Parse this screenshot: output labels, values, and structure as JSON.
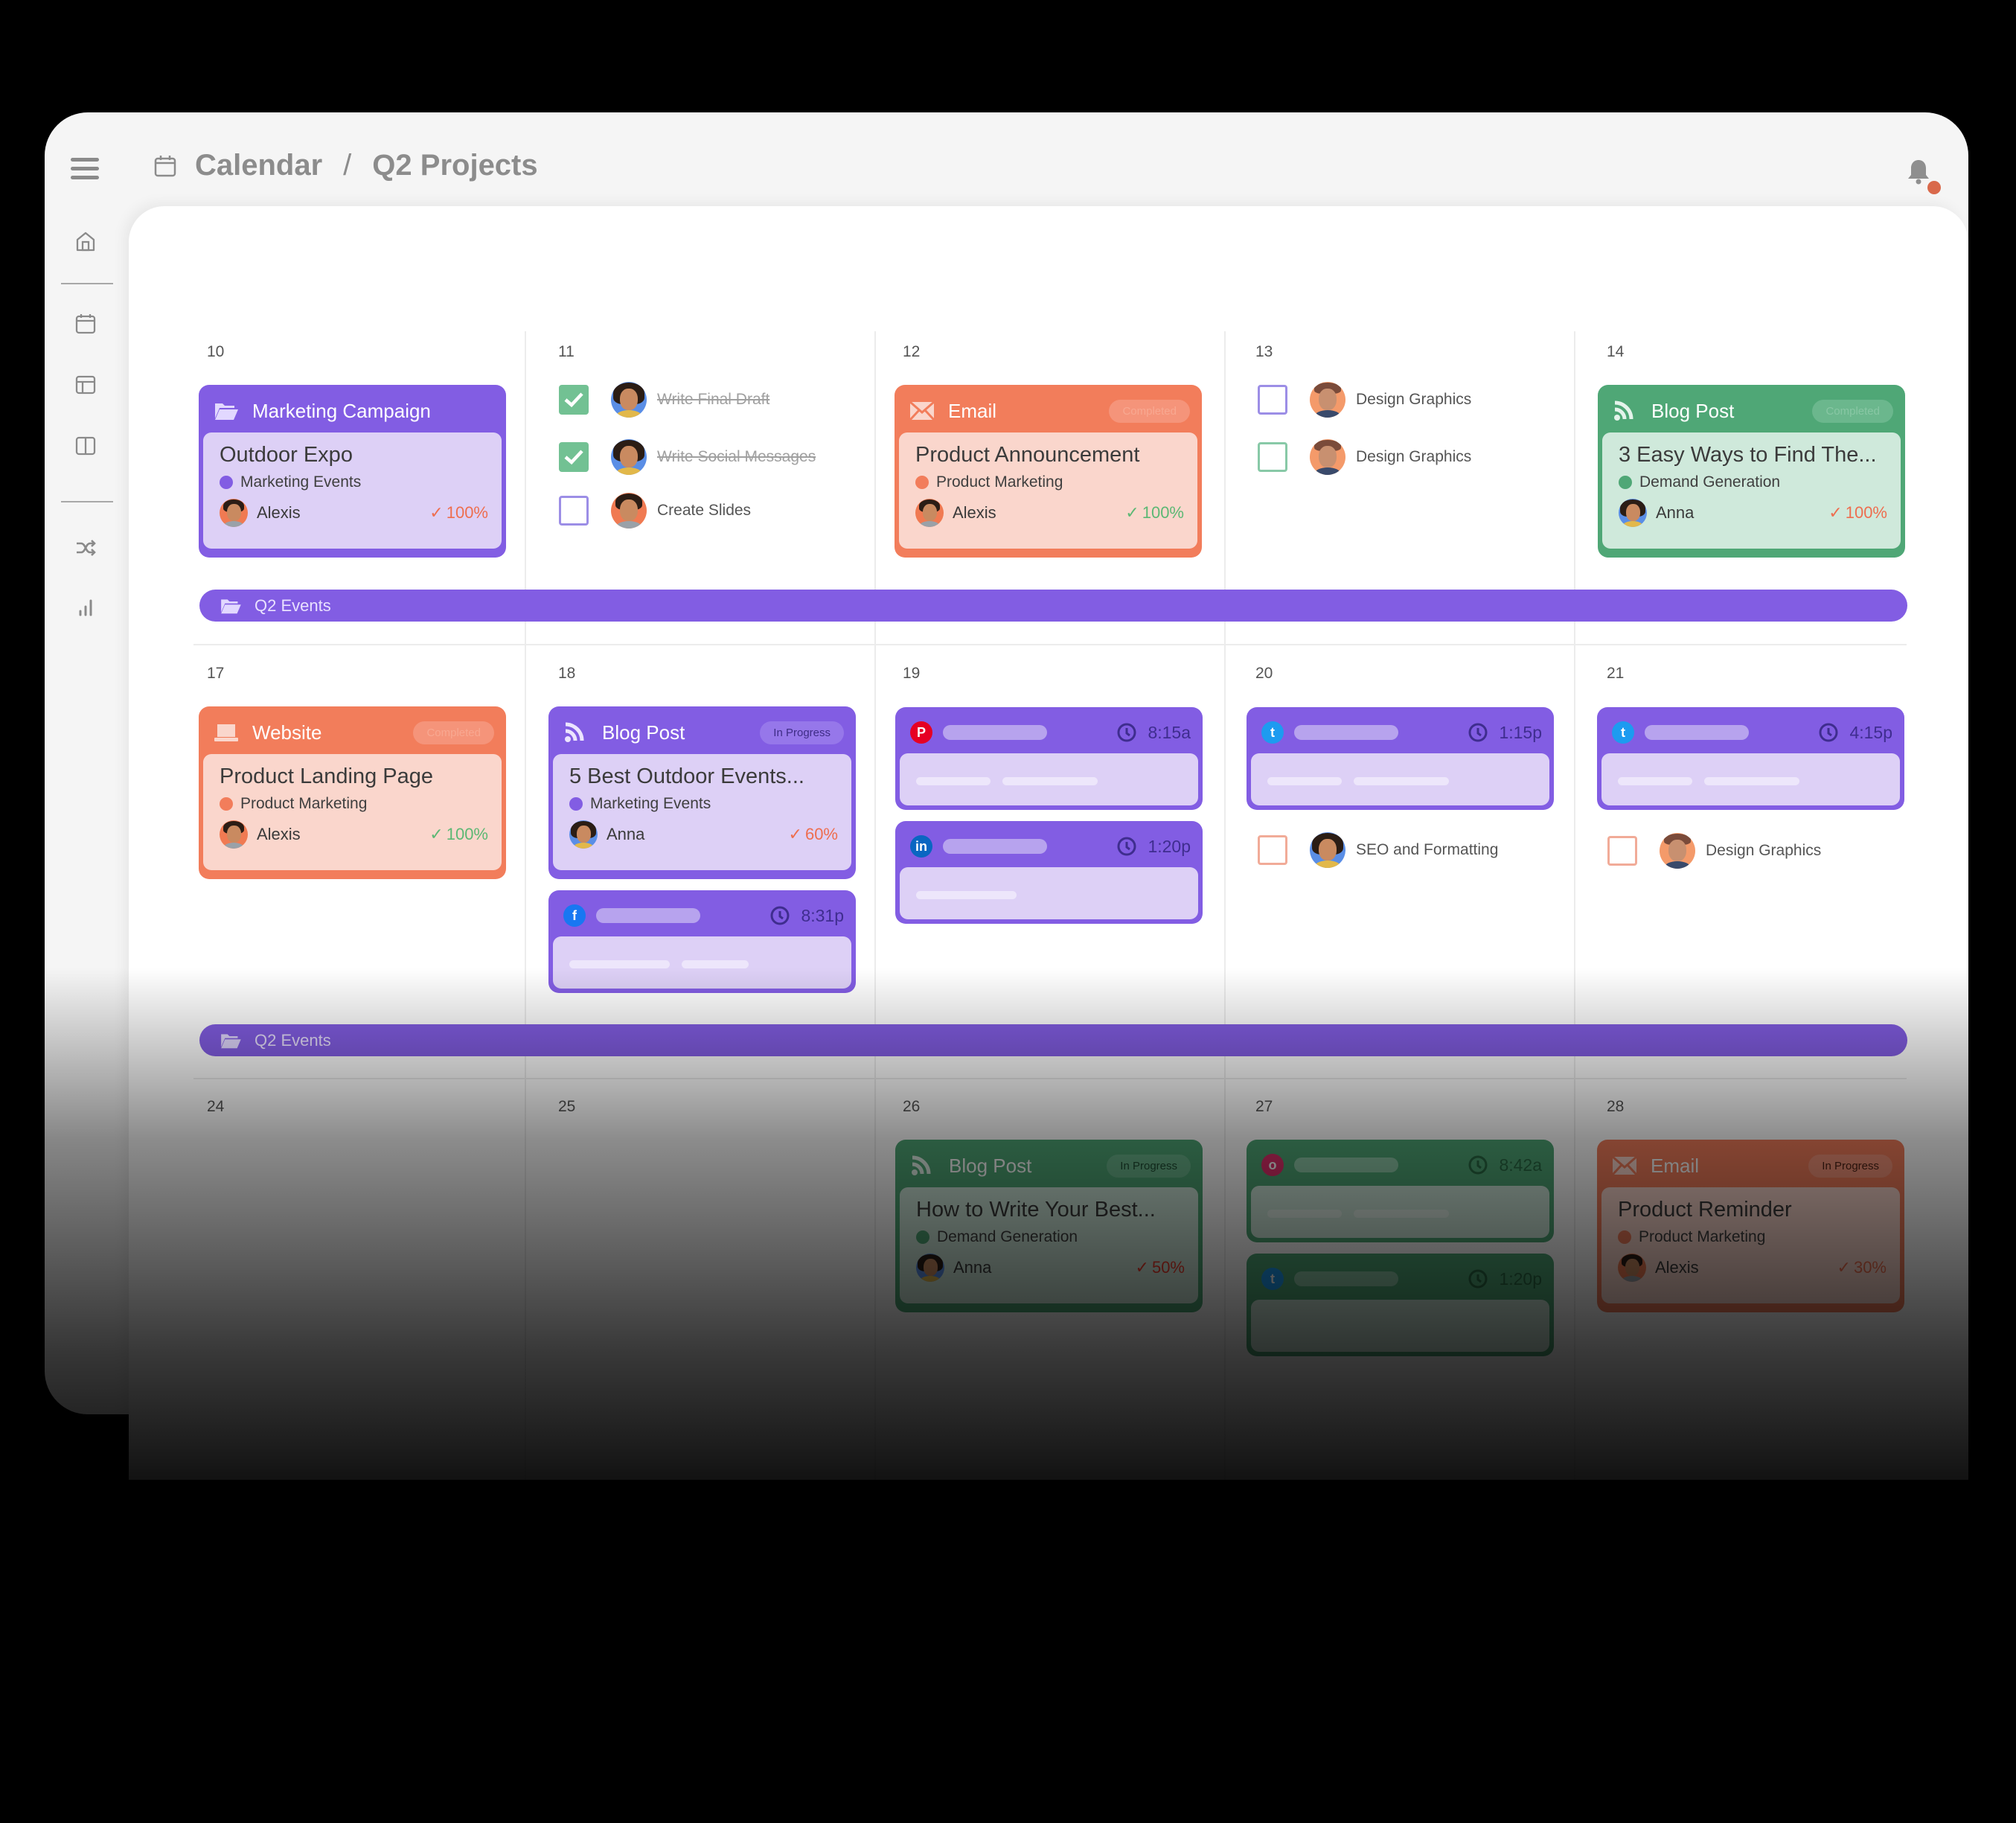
{
  "header": {
    "menu_icon": "hamburger-menu-icon",
    "breadcrumb": {
      "icon": "calendar-icon",
      "root": "Calendar",
      "separator": "/",
      "current": "Q2 Projects"
    },
    "notification_icon": "bell-icon",
    "notification_dot_color": "#d9694b"
  },
  "sidebar": {
    "items": [
      {
        "icon": "home-icon"
      },
      {
        "icon": "calendar-icon"
      },
      {
        "icon": "layout-icon"
      },
      {
        "icon": "columns-icon"
      },
      {
        "icon": "shuffle-icon"
      },
      {
        "icon": "bar-chart-icon"
      }
    ]
  },
  "colors": {
    "purple": "#825de3",
    "orange": "#f27d5b",
    "green": "#4fa776",
    "check_green": "#72c193",
    "pct_green": "#5cb874",
    "pct_orange": "#ee6e4f"
  },
  "calendar": {
    "weeks": [
      {
        "days": [
          "10",
          "11",
          "12",
          "13",
          "14"
        ],
        "banner": {
          "label": "Q2 Events",
          "icon": "folder-open-icon"
        }
      },
      {
        "days": [
          "17",
          "18",
          "19",
          "20",
          "21"
        ],
        "banner": {
          "label": "Q2 Events",
          "icon": "folder-open-icon"
        }
      },
      {
        "days": [
          "24",
          "25",
          "26",
          "27",
          "28"
        ]
      }
    ],
    "cards": {
      "d10": {
        "type": "Marketing Campaign",
        "icon": "folder-open-icon",
        "title": "Outdoor Expo",
        "tag": "Marketing Events",
        "assignee": "Alexis",
        "progress": "100%"
      },
      "d12": {
        "type": "Email",
        "icon": "envelope-icon",
        "status": "Completed",
        "title": "Product Announcement",
        "tag": "Product Marketing",
        "assignee": "Alexis",
        "progress": "100%"
      },
      "d14": {
        "type": "Blog Post",
        "icon": "rss-icon",
        "status": "Completed",
        "title": "3 Easy Ways to Find The...",
        "tag": "Demand Generation",
        "assignee": "Anna",
        "progress": "100%"
      },
      "d17": {
        "type": "Website",
        "icon": "laptop-icon",
        "status": "Completed",
        "title": "Product Landing Page",
        "tag": "Product Marketing",
        "assignee": "Alexis",
        "progress": "100%"
      },
      "d18": {
        "type": "Blog Post",
        "icon": "rss-icon",
        "status": "In Progress",
        "title": "5 Best Outdoor Events...",
        "tag": "Marketing Events",
        "assignee": "Anna",
        "progress": "60%"
      },
      "d26": {
        "type": "Blog Post",
        "icon": "rss-icon",
        "status": "In Progress",
        "title": "How to Write Your Best...",
        "tag": "Demand Generation",
        "assignee": "Anna",
        "progress": "50%"
      },
      "d28": {
        "type": "Email",
        "icon": "envelope-icon",
        "status": "In Progress",
        "title": "Product Reminder",
        "tag": "Product Marketing",
        "assignee": "Alexis",
        "progress": "30%"
      }
    },
    "social_posts": {
      "d18": {
        "network": "facebook",
        "glyph": "f",
        "time": "8:31p"
      },
      "d19a": {
        "network": "pinterest",
        "glyph": "P",
        "time": "8:15a"
      },
      "d19b": {
        "network": "linkedin",
        "glyph": "in",
        "time": "1:20p"
      },
      "d20": {
        "network": "twitter",
        "glyph": "t",
        "time": "1:15p"
      },
      "d21": {
        "network": "twitter",
        "glyph": "t",
        "time": "4:15p"
      },
      "d27a": {
        "network": "instagram",
        "glyph": "o",
        "time": "8:42a"
      },
      "d27b": {
        "network": "twitter",
        "glyph": "t",
        "time": "1:20p"
      }
    },
    "tasks": {
      "d11": [
        {
          "label": "Write Final Draft",
          "done": true
        },
        {
          "label": "Write Social Messages",
          "done": true
        },
        {
          "label": "Create Slides",
          "done": false
        }
      ],
      "d13": [
        {
          "label": "Design Graphics",
          "done": false
        },
        {
          "label": "Design Graphics",
          "done": false
        }
      ],
      "d20": [
        {
          "label": "SEO and Formatting",
          "done": false
        }
      ],
      "d21": [
        {
          "label": "Design Graphics",
          "done": false
        }
      ]
    }
  }
}
